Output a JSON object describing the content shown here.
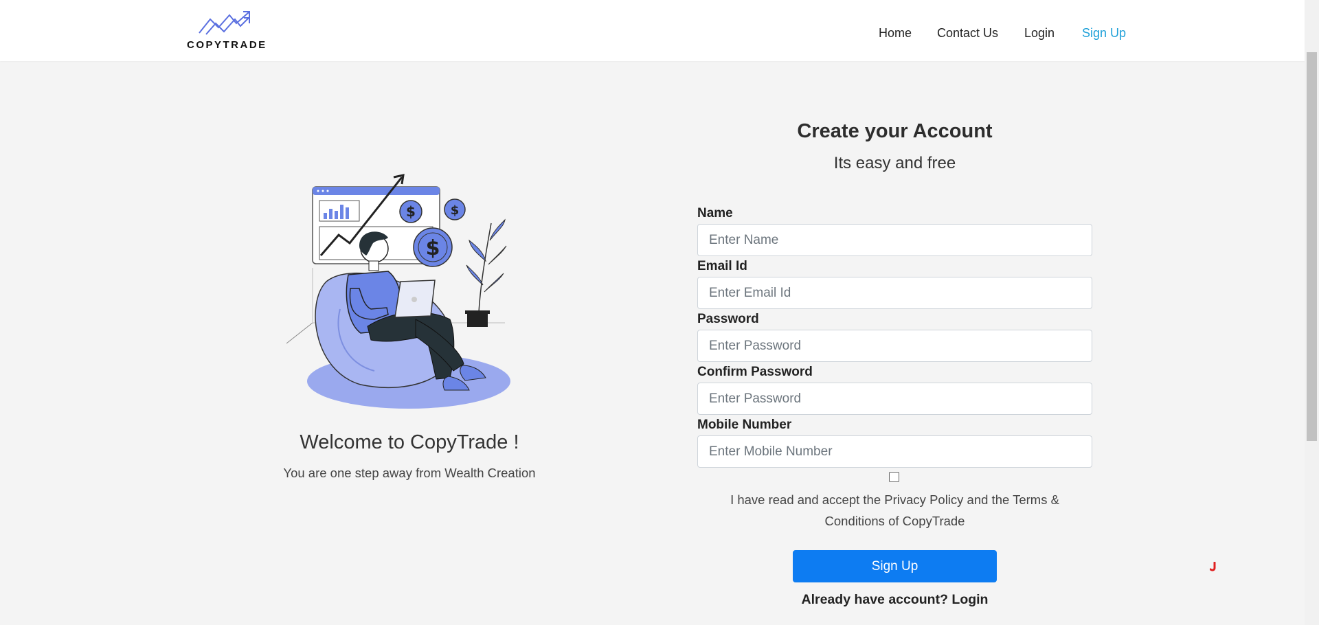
{
  "brand": {
    "name": "COPYTRADE"
  },
  "nav": {
    "home": "Home",
    "contact": "Contact Us",
    "login": "Login",
    "signup": "Sign Up"
  },
  "colors": {
    "accent": "#1ea0d8",
    "button": "#0d7cf2",
    "illustration": "#6b85e6"
  },
  "welcome": {
    "title": "Welcome to CopyTrade !",
    "subtitle": "You are one step away from Wealth Creation"
  },
  "form": {
    "title": "Create your Account",
    "subtitle": "Its easy and free",
    "fields": [
      {
        "label": "Name",
        "placeholder": "Enter Name",
        "value": ""
      },
      {
        "label": "Email Id",
        "placeholder": "Enter Email Id",
        "value": ""
      },
      {
        "label": "Password",
        "placeholder": "Enter Password",
        "value": ""
      },
      {
        "label": "Confirm Password",
        "placeholder": "Enter Password",
        "value": ""
      },
      {
        "label": "Mobile Number",
        "placeholder": "Enter Mobile Number",
        "value": ""
      }
    ],
    "terms": "I have read and accept the Privacy Policy and the Terms & Conditions of CopyTrade",
    "terms_checked": false,
    "submit": "Sign Up",
    "login_prompt": "Already have account? Login"
  }
}
